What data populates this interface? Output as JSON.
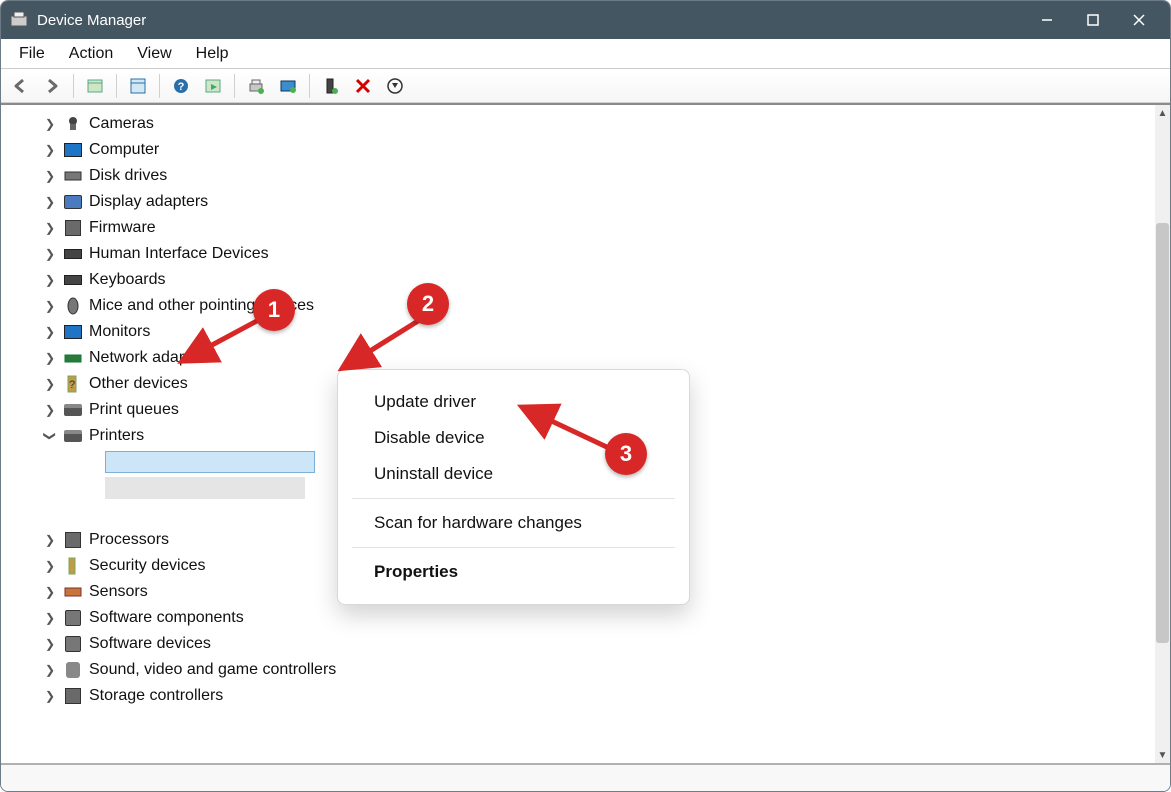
{
  "window": {
    "title": "Device Manager"
  },
  "menubar": [
    "File",
    "Action",
    "View",
    "Help"
  ],
  "toolbar_icons": [
    "back-icon",
    "forward-icon",
    "properties-icon",
    "refresh-icon",
    "help-icon",
    "scan-icon",
    "update-driver-icon",
    "device-icon",
    "enable-icon",
    "uninstall-icon",
    "show-hidden-icon"
  ],
  "tree": [
    {
      "label": "Cameras",
      "icon": "camera",
      "state": "col"
    },
    {
      "label": "Computer",
      "icon": "computer",
      "state": "col"
    },
    {
      "label": "Disk drives",
      "icon": "disk",
      "state": "col"
    },
    {
      "label": "Display adapters",
      "icon": "display",
      "state": "col"
    },
    {
      "label": "Firmware",
      "icon": "firmware",
      "state": "col"
    },
    {
      "label": "Human Interface Devices",
      "icon": "hid",
      "state": "col"
    },
    {
      "label": "Keyboards",
      "icon": "keyboard",
      "state": "col"
    },
    {
      "label": "Mice and other pointing devices",
      "icon": "mouse",
      "state": "col"
    },
    {
      "label": "Monitors",
      "icon": "monitor",
      "state": "col"
    },
    {
      "label": "Network adapters",
      "icon": "network",
      "state": "col"
    },
    {
      "label": "Other devices",
      "icon": "other",
      "state": "col"
    },
    {
      "label": "Print queues",
      "icon": "printqueue",
      "state": "col"
    },
    {
      "label": "Printers",
      "icon": "printer",
      "state": "exp",
      "children": [
        {
          "selected": true
        },
        {
          "grey": true
        },
        {
          "grey": false
        }
      ]
    },
    {
      "label": "Processors",
      "icon": "processor",
      "state": "col"
    },
    {
      "label": "Security devices",
      "icon": "security",
      "state": "col"
    },
    {
      "label": "Sensors",
      "icon": "sensor",
      "state": "col"
    },
    {
      "label": "Software components",
      "icon": "swcomp",
      "state": "col"
    },
    {
      "label": "Software devices",
      "icon": "swdev",
      "state": "col"
    },
    {
      "label": "Sound, video and game controllers",
      "icon": "sound",
      "state": "col"
    },
    {
      "label": "Storage controllers",
      "icon": "storage",
      "state": "col"
    }
  ],
  "context_menu": {
    "items": [
      "Update driver",
      "Disable device",
      "Uninstall device"
    ],
    "items2": [
      "Scan for hardware changes"
    ],
    "items3": [
      "Properties"
    ]
  },
  "annotations": {
    "b1": "1",
    "b2": "2",
    "b3": "3"
  }
}
